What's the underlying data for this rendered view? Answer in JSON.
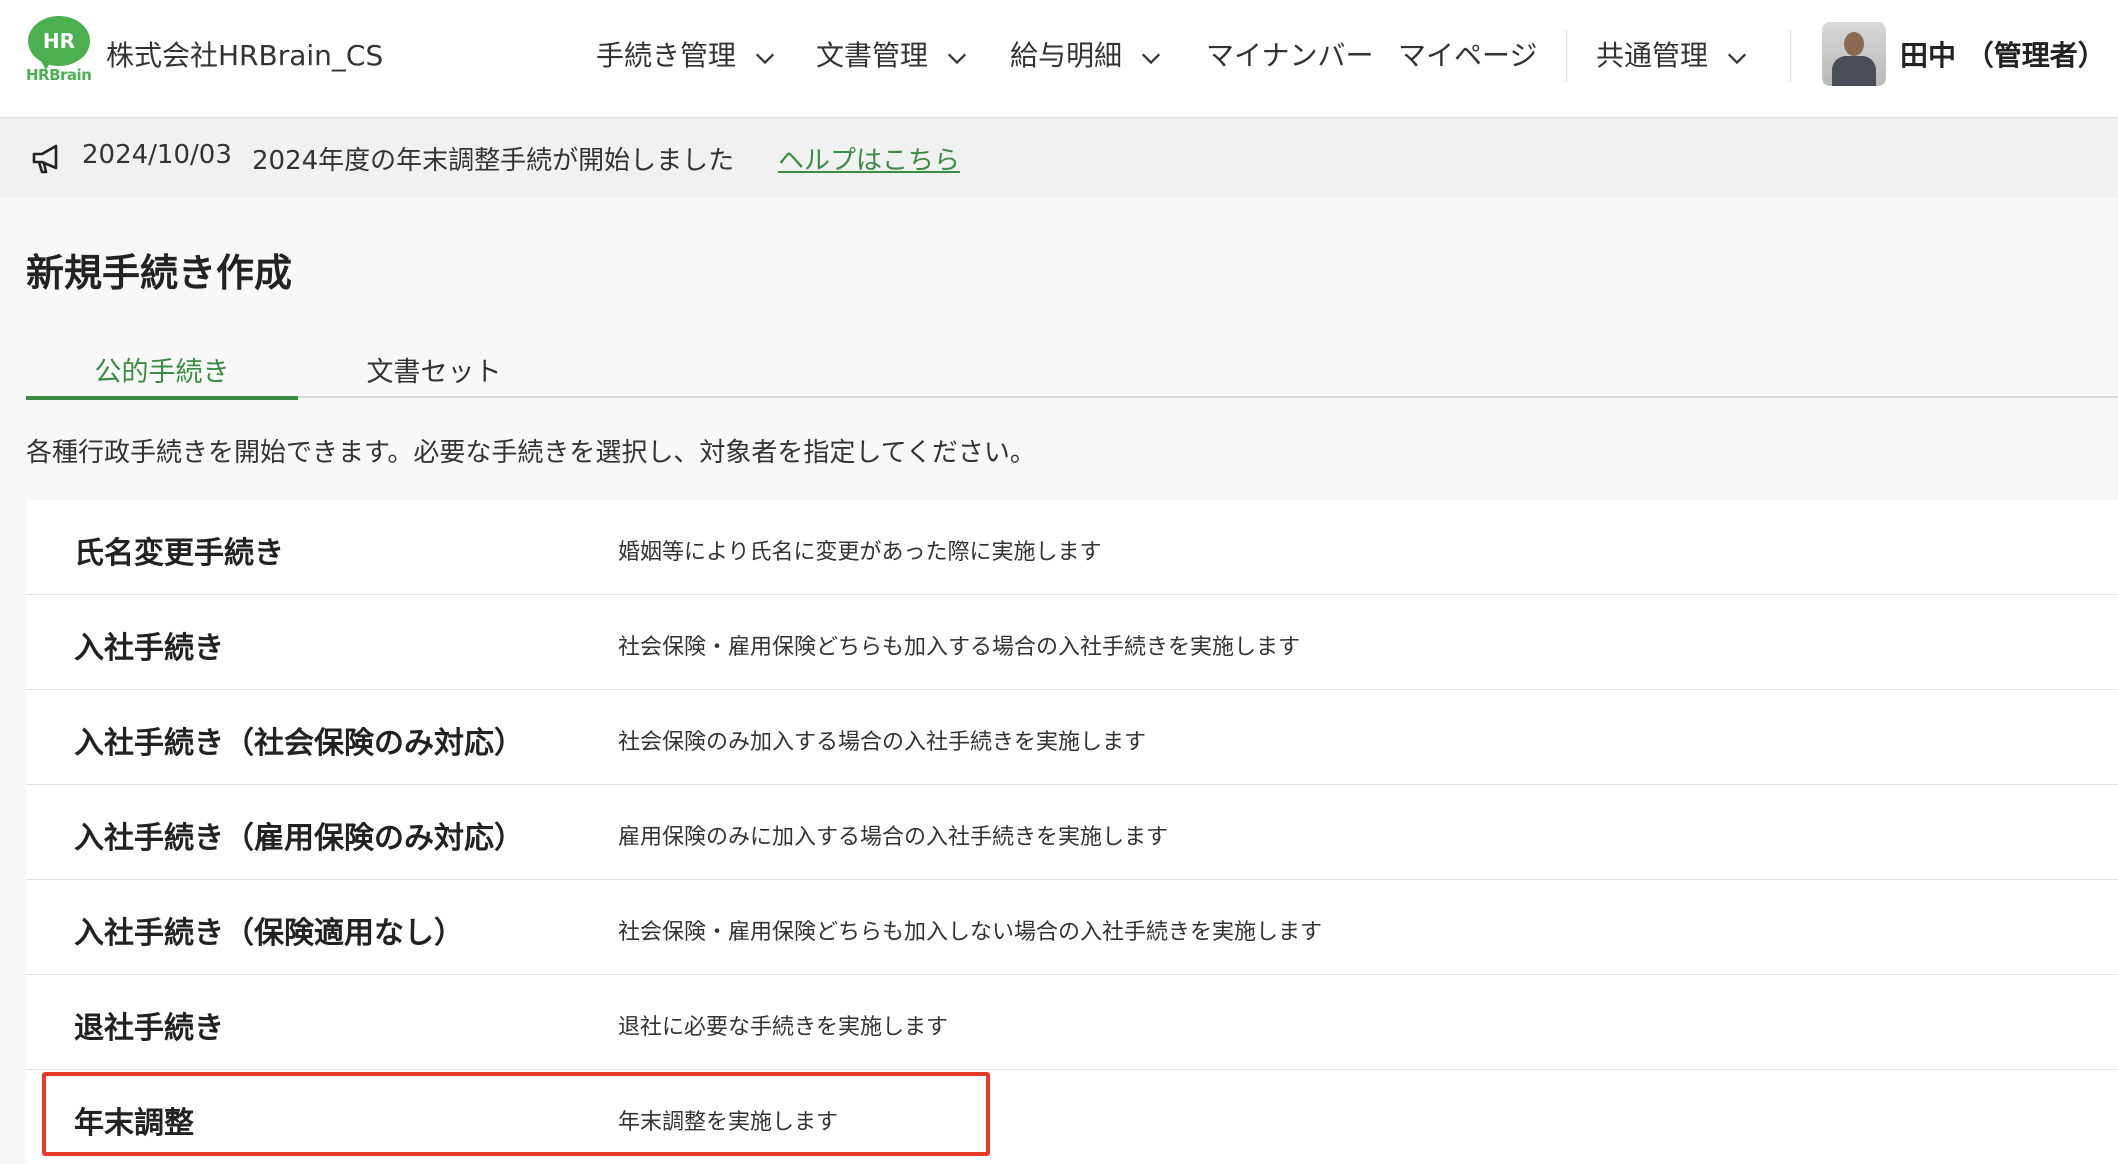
{
  "header": {
    "logo_text": "HR",
    "logo_word": "HRBrain",
    "company": "株式会社HRBrain_CS",
    "nav": [
      {
        "label": "手続き管理",
        "dropdown": true
      },
      {
        "label": "文書管理",
        "dropdown": true
      },
      {
        "label": "給与明細",
        "dropdown": true
      },
      {
        "label": "マイナンバー",
        "dropdown": false
      },
      {
        "label": "マイページ",
        "dropdown": false
      },
      {
        "label": "共通管理",
        "dropdown": true
      }
    ],
    "user": "田中 （管理者）"
  },
  "announcement": {
    "date": "2024/10/03",
    "message": "2024年度の年末調整手続が開始しました",
    "link": "ヘルプはこちら"
  },
  "page": {
    "title": "新規手続き作成",
    "tabs": [
      "公的手続き",
      "文書セット"
    ],
    "active_tab": 0,
    "description": "各種行政手続きを開始できます。必要な手続きを選択し、対象者を指定してください。"
  },
  "procedures": [
    {
      "name": "氏名変更手続き",
      "desc": "婚姻等により氏名に変更があった際に実施します"
    },
    {
      "name": "入社手続き",
      "desc": "社会保険・雇用保険どちらも加入する場合の入社手続きを実施します"
    },
    {
      "name": "入社手続き（社会保険のみ対応）",
      "desc": "社会保険のみ加入する場合の入社手続きを実施します"
    },
    {
      "name": "入社手続き（雇用保険のみ対応）",
      "desc": "雇用保険のみに加入する場合の入社手続きを実施します"
    },
    {
      "name": "入社手続き（保険適用なし）",
      "desc": "社会保険・雇用保険どちらも加入しない場合の入社手続きを実施します"
    },
    {
      "name": "退社手続き",
      "desc": "退社に必要な手続きを実施します"
    },
    {
      "name": "年末調整",
      "desc": "年末調整を実施します"
    }
  ],
  "colors": {
    "accent": "#3b8c43",
    "highlight": "#e53a2a",
    "logo": "#4caf50"
  }
}
